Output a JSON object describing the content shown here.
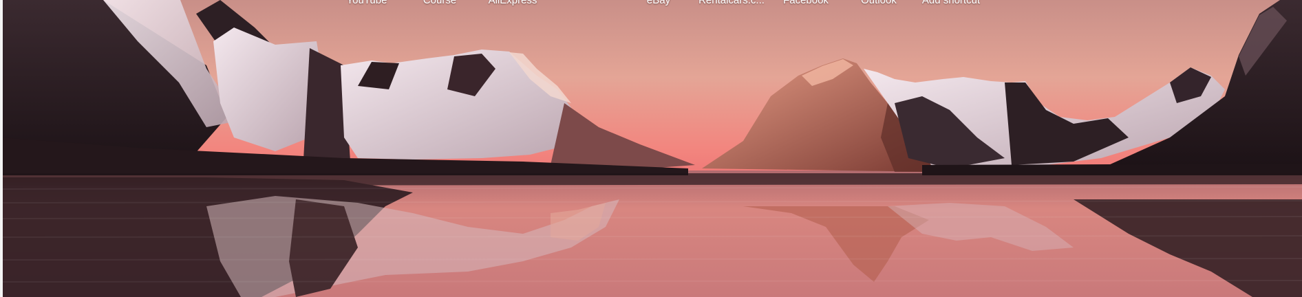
{
  "shortcuts": [
    {
      "label": "YouTube"
    },
    {
      "label": "Course"
    },
    {
      "label": "AliExpress"
    },
    {
      "label": "eBay"
    },
    {
      "label": "Rentalcars.c..."
    },
    {
      "label": "Facebook"
    },
    {
      "label": "Outlook"
    },
    {
      "label": "Add shortcut"
    }
  ],
  "colors": {
    "sky_top": "#d4958a",
    "sky_mid": "#e89a8e",
    "horizon_glow": "#f08a86",
    "water": "#c97c7c",
    "mountain_dark": "#2a1a1e",
    "snow": "#e8dbe0",
    "sunlit_peak": "#b4604e"
  }
}
